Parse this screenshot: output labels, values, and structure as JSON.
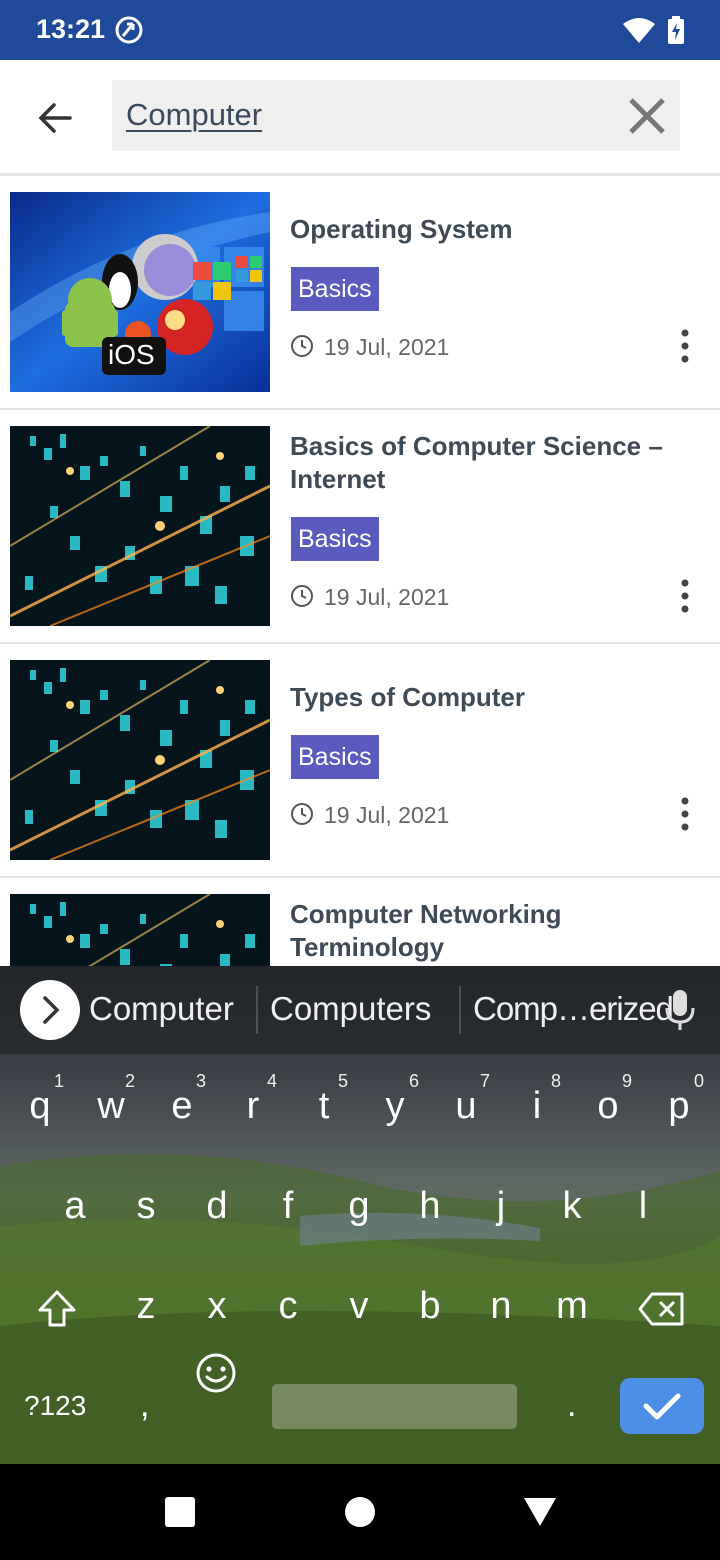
{
  "status_bar": {
    "time": "13:21"
  },
  "search": {
    "query": "Computer"
  },
  "articles": [
    {
      "title": "Operating System",
      "category": "Basics",
      "date": "19 Jul, 2021",
      "thumbnail_badge": "iOS"
    },
    {
      "title": "Basics of Computer Science – Internet",
      "category": "Basics",
      "date": "19 Jul, 2021"
    },
    {
      "title": "Types of Computer",
      "category": "Basics",
      "date": "19 Jul, 2021"
    },
    {
      "title": "Computer Networking Terminology"
    }
  ],
  "keyboard": {
    "suggestions": [
      "Computer",
      "Computers",
      "Comp…erized"
    ],
    "row1": [
      "q",
      "w",
      "e",
      "r",
      "t",
      "y",
      "u",
      "i",
      "o",
      "p"
    ],
    "row1_hints": [
      "1",
      "2",
      "3",
      "4",
      "5",
      "6",
      "7",
      "8",
      "9",
      "0"
    ],
    "row2": [
      "a",
      "s",
      "d",
      "f",
      "g",
      "h",
      "j",
      "k",
      "l"
    ],
    "row3": [
      "z",
      "x",
      "c",
      "v",
      "b",
      "n",
      "m"
    ],
    "symbols_key": "?123",
    "comma": ",",
    "period": ".",
    "accent_color": "#4d8ee6"
  },
  "colors": {
    "status_bar": "#1f4a9a",
    "badge": "#5b5bbf"
  }
}
